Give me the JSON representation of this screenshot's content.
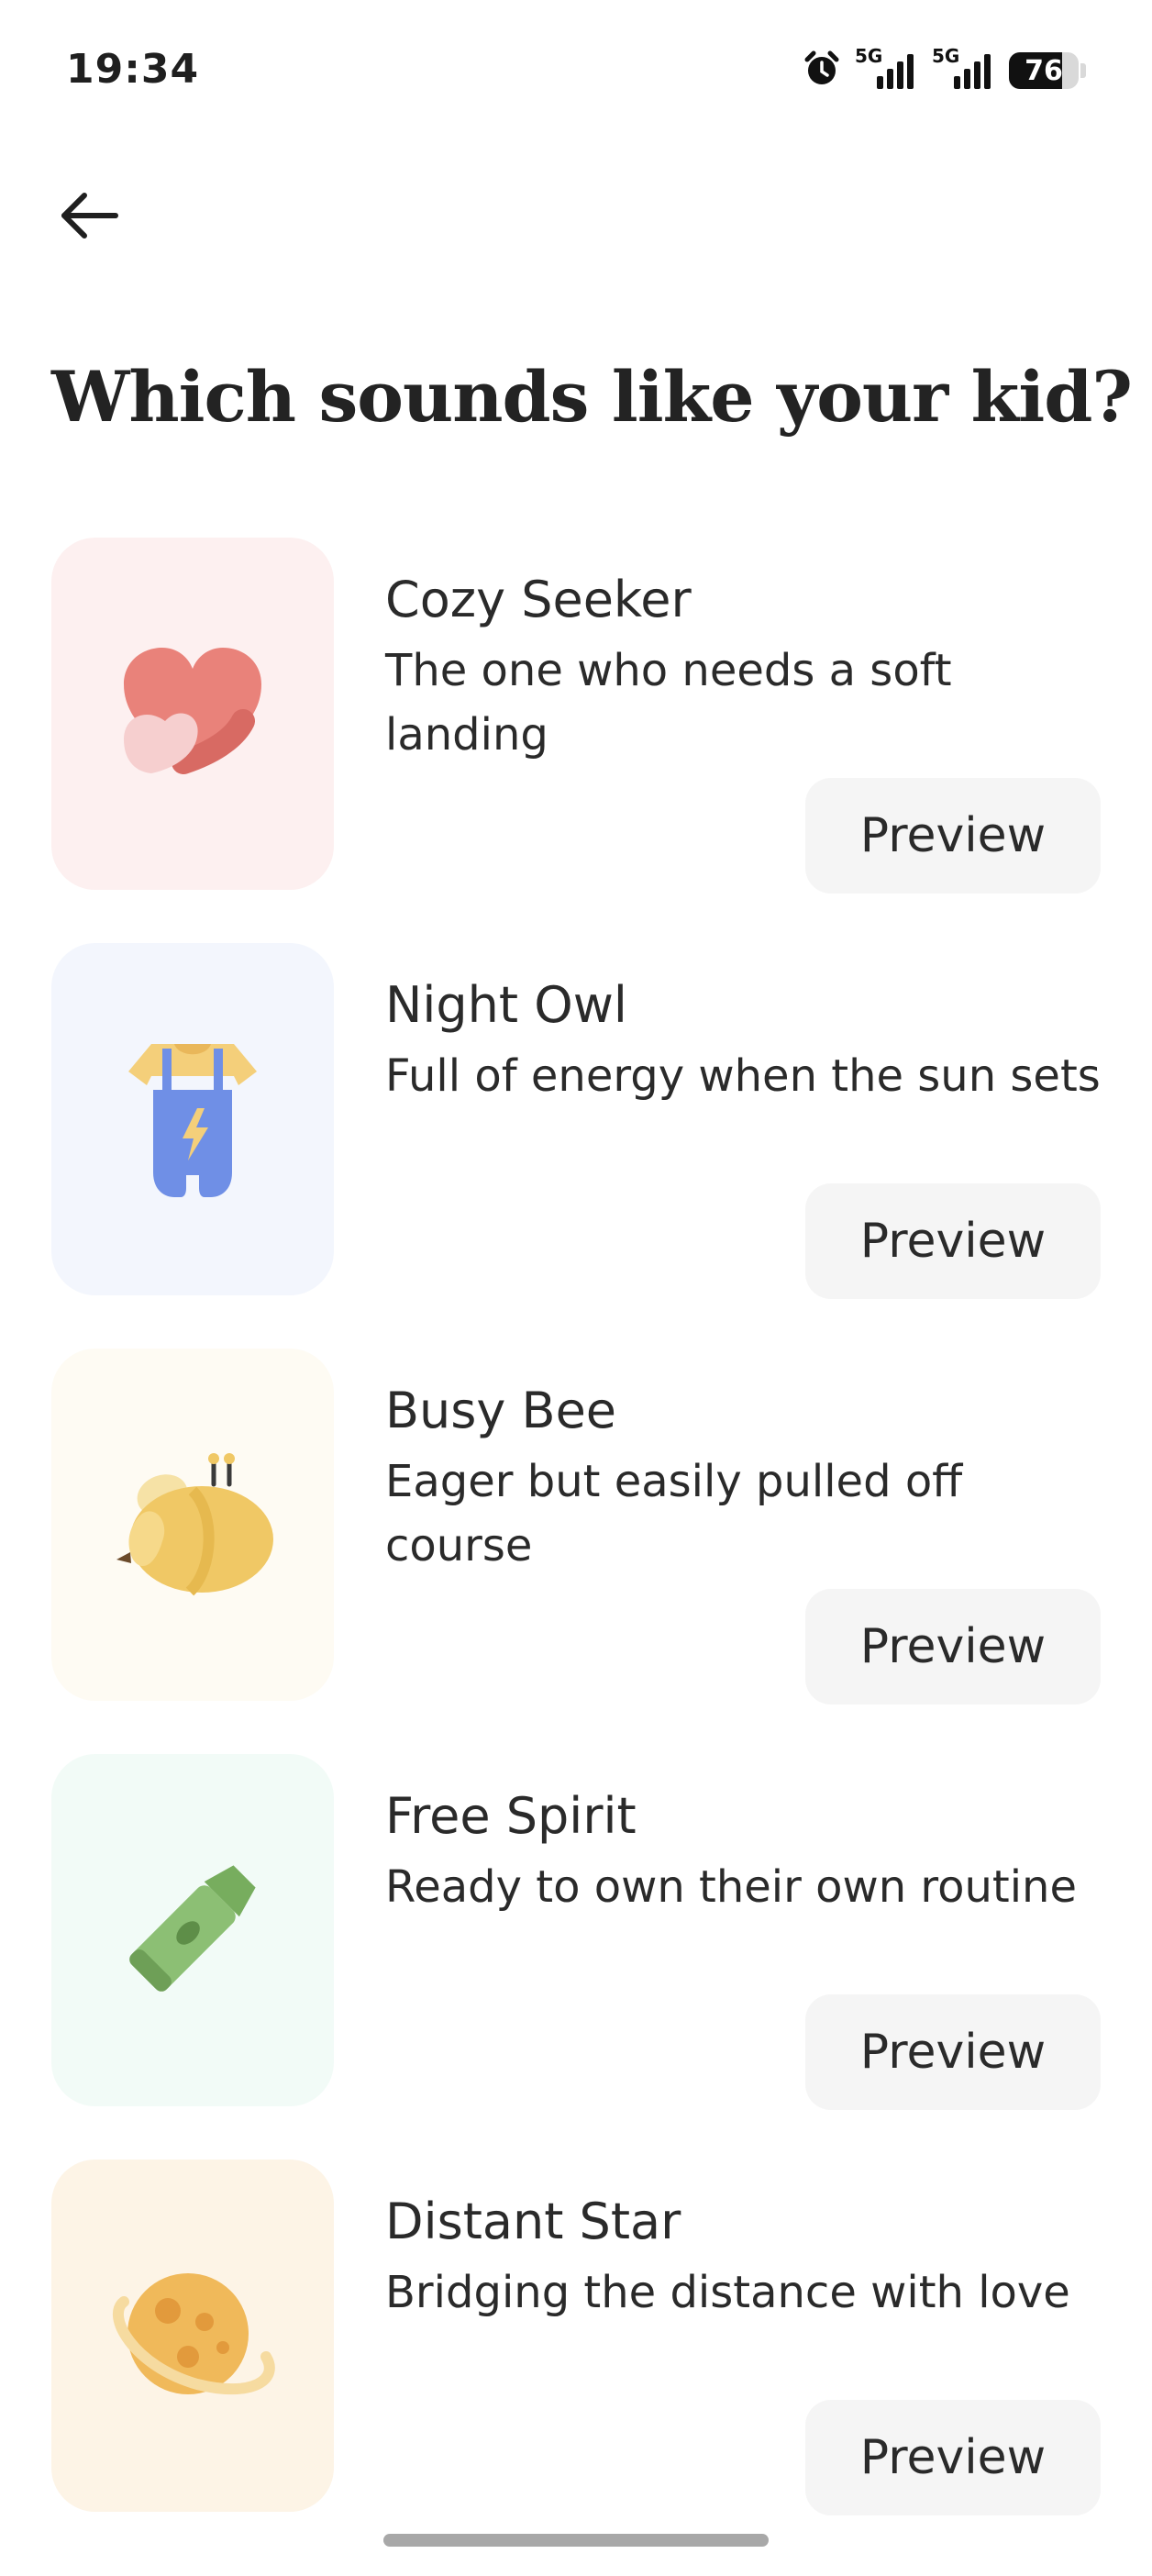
{
  "status_bar": {
    "time": "19:34",
    "battery_level": "76",
    "battery_fraction": 0.76,
    "icons": [
      "alarm-icon",
      "signal-5g-icon",
      "signal-5g-icon",
      "battery-icon"
    ],
    "network_label_1": "5G",
    "network_label_2": "5G"
  },
  "nav": {
    "back_icon": "arrow-left-icon"
  },
  "page": {
    "title": "Which sounds like your kid?"
  },
  "profiles": [
    {
      "title": "Cozy Seeker",
      "description": "The one who needs a soft landing",
      "preview_label": "Preview",
      "icon": "heart-hands-icon",
      "background": "#fdf0f0"
    },
    {
      "title": "Night Owl",
      "description": "Full of energy when the sun sets",
      "preview_label": "Preview",
      "icon": "overalls-icon",
      "background": "#f3f6fd"
    },
    {
      "title": "Busy Bee",
      "description": "Eager but easily pulled off course",
      "preview_label": "Preview",
      "icon": "bee-icon",
      "background": "#fefbf3"
    },
    {
      "title": "Free Spirit",
      "description": "Ready to own their own routine",
      "preview_label": "Preview",
      "icon": "crayon-icon",
      "background": "#f2fbf7"
    },
    {
      "title": "Distant Star",
      "description": "Bridging the distance with love",
      "preview_label": "Preview",
      "icon": "planet-icon",
      "background": "#fdf4e6"
    }
  ],
  "colors": {
    "text": "#2a2a2a",
    "button_bg": "#f5f5f5",
    "heart": "#e9827a",
    "overalls": "#6f8fe6",
    "bee": "#f0c865",
    "crayon": "#8cbf74",
    "planet": "#f0b95a"
  }
}
